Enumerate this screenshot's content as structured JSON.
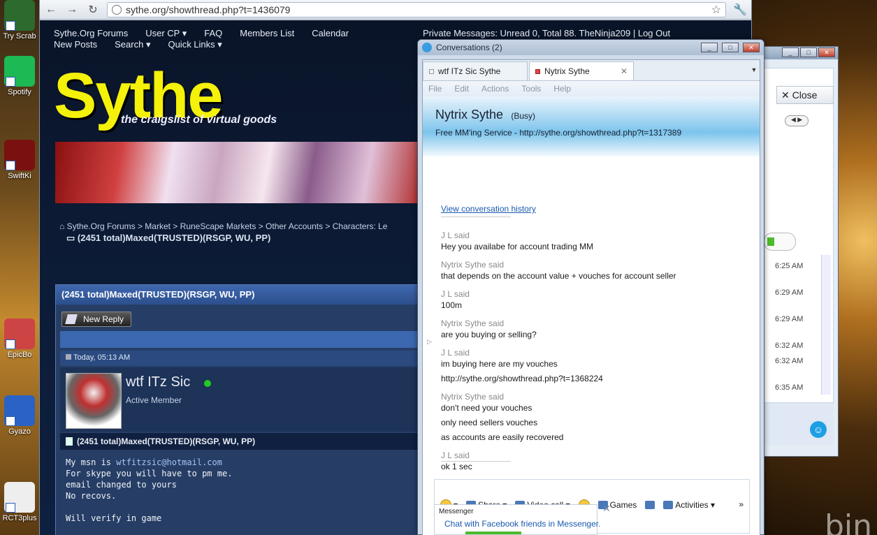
{
  "desktop": {
    "icons": [
      {
        "label": "Try Scrab",
        "color": "#2d6a2d"
      },
      {
        "label": "Spotify",
        "color": "#1db954"
      },
      {
        "label": "SwiftKi",
        "color": "#7a1010"
      },
      {
        "label": "EpicBo",
        "color": "#c44"
      },
      {
        "label": "Gyazo",
        "color": "#2a62c6"
      },
      {
        "label": "RCT3plus",
        "color": "#eee"
      }
    ],
    "bing_text": "bin"
  },
  "browser": {
    "url": "sythe.org/showthread.php?t=1436079",
    "nav_row1": [
      "Sythe.Org Forums",
      "User CP ▾",
      "FAQ",
      "Members List",
      "Calendar"
    ],
    "nav_row2": [
      "New Posts",
      "Search ▾",
      "Quick Links ▾"
    ],
    "pm_text": "Private Messages: Unread 0, Total 88.      TheNinja209 | Log Out",
    "logo": "Sythe",
    "tagline": "the craigslist of virtual goods",
    "breadcrumb": "Sythe.Org Forums > Market > RuneScape Markets > Other Accounts > Characters: Le",
    "crumb_title": "(2451 total)Maxed(TRUSTED)(RSGP, WU, PP)",
    "thread_title": "(2451 total)Maxed(TRUSTED)(RSGP, WU, PP)",
    "new_reply": "New Reply",
    "post_date": "Today, 05:13 AM",
    "username": "wtf ITz Sic",
    "user_title": "Active Member",
    "post_title": "(2451 total)Maxed(TRUSTED)(RSGP, WU, PP)",
    "post_lines": [
      {
        "text": "My msn is ",
        "link": "wtfitzsic@hotmail.com"
      },
      {
        "text": "For skype you will have to pm me.",
        "link": ""
      },
      {
        "text": "email changed to yours",
        "link": ""
      },
      {
        "text": "No recovs.",
        "link": ""
      },
      {
        "text": "",
        "link": ""
      },
      {
        "text": "Will verify in game",
        "link": ""
      }
    ]
  },
  "msn_back": {
    "close_label": "Close",
    "times": [
      "6:25 AM",
      "6:29 AM",
      "6:29 AM",
      "6:32 AM",
      "6:32 AM",
      "6:35 AM"
    ]
  },
  "conversation": {
    "window_title": "Conversations (2)",
    "tabs": [
      {
        "label": "wtf ITz Sic Sythe",
        "active": false
      },
      {
        "label": "Nytrix Sythe",
        "active": true
      }
    ],
    "menu": [
      "File",
      "Edit",
      "Actions",
      "Tools",
      "Help"
    ],
    "contact_name": "Nytrix Sythe",
    "contact_status": "(Busy)",
    "contact_psm": "Free MM'ing Service - http://sythe.org/showthread.php?t=1317389",
    "history_link": "View conversation history",
    "messages": [
      {
        "sender": "J L said",
        "lines": [
          "Hey you availabe for account trading MM"
        ]
      },
      {
        "sender": "Nytrix Sythe said",
        "lines": [
          "that depends on the account value + vouches for account seller"
        ]
      },
      {
        "sender": "J L said",
        "lines": [
          "100m"
        ]
      },
      {
        "sender": "Nytrix Sythe said",
        "lines": [
          "are you buying or selling?"
        ]
      },
      {
        "sender": "J L said",
        "lines": [
          "im buying here are my vouches",
          "http://sythe.org/showthread.php?t=1368224"
        ]
      },
      {
        "sender": "Nytrix Sythe said",
        "lines": [
          "don't need your vouches",
          "only need sellers vouches",
          "as accounts are easily recovered"
        ]
      },
      {
        "sender": "J L said",
        "lines": [
          "ok 1 sec"
        ]
      }
    ],
    "toolbar": [
      "Share ▾",
      "Video call ▾",
      "Games",
      "Activities ▾"
    ],
    "toolbar_more": "»",
    "ad_brand": "Messenger",
    "ad_text": "Chat with Facebook friends in Messenger."
  }
}
